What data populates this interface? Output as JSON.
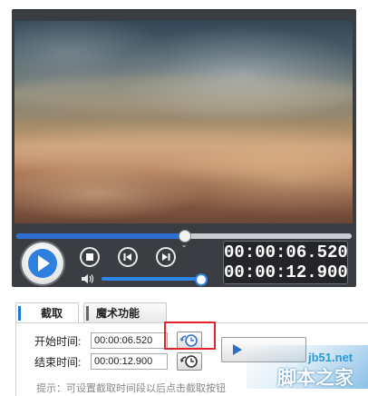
{
  "player": {
    "progress": 0.5,
    "volume": 0.95,
    "current_time": "00:00:06.520",
    "total_time": "00:00:12.900"
  },
  "tabs": [
    {
      "label": "截取",
      "active": true,
      "accent": "#1f78d1"
    },
    {
      "label": "魔术功能",
      "active": false,
      "accent": "#666666"
    }
  ],
  "form": {
    "start_label": "开始时间:",
    "start_value": "00:00:06.520",
    "end_label": "结束时间:",
    "end_value": "00:00:12.900",
    "hint": "提示：可设置截取时间段以后点击截取按钮"
  },
  "watermark": {
    "site": "jb51.net",
    "name": "脚本之家"
  },
  "colors": {
    "accent": "#2e6fd1",
    "highlight": "#e3242b",
    "volume": "#2e86e6"
  }
}
